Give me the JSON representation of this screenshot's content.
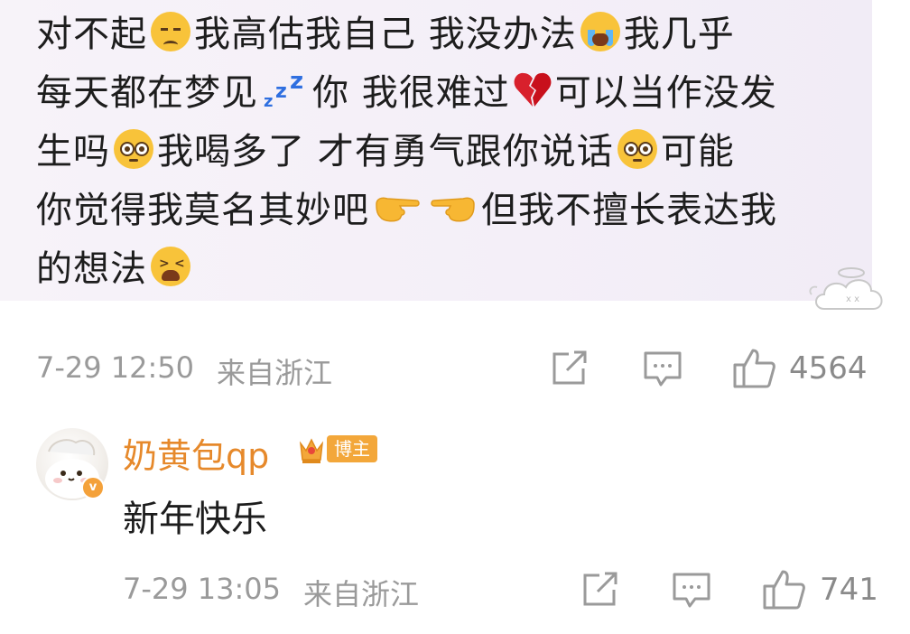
{
  "comment": {
    "lines": [
      [
        "对不起",
        "pensive",
        "我高估我自己 我没办法",
        "crying",
        "我几乎"
      ],
      [
        "每天都在梦见",
        "zzz",
        "你 我很难过",
        "broken-heart",
        "可以当作没发"
      ],
      [
        "生吗",
        "pleading",
        "我喝多了 才有勇气跟你说话",
        "pleading",
        "可能"
      ],
      [
        "你觉得我莫名其妙吧",
        "hand-left",
        "hand-right",
        "但我不擅长表达我"
      ],
      [
        "的想法",
        "tired"
      ]
    ],
    "time": "7-29 12:50",
    "location": "来自浙江",
    "like_count": "4564"
  },
  "reply": {
    "username": "奶黄包qp",
    "badge": "博主",
    "text": "新年快乐",
    "time": "7-29 13:05",
    "location": "来自浙江",
    "like_count": "741"
  },
  "colors": {
    "username": "#e6892b",
    "badge": "#f3a73a",
    "meta": "#9a9a9a"
  }
}
